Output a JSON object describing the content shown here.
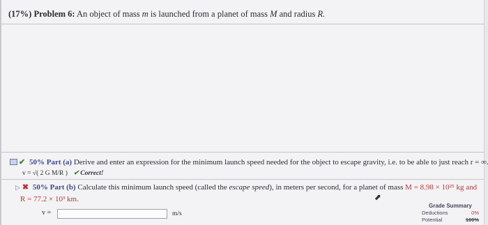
{
  "problem": {
    "percent": "(17%)",
    "label": "Problem 6:",
    "text": "An object of mass",
    "mass_var": "m",
    "text2": "is launched from a planet of mass",
    "planet_mass_var": "M",
    "text3": "and radius",
    "radius_var": "R."
  },
  "part_a": {
    "percent": "50%",
    "label": "Part (a)",
    "description": "Derive and enter an expression for the minimum launch speed needed for the object to escape gravity, i.e. to be able to just reach r = ∞.",
    "answer": "v = √( 2 G M/R )",
    "status": "Correct!"
  },
  "part_b": {
    "percent": "50%",
    "label": "Part (b)",
    "description_pre": "Calculate this minimum launch speed (called the",
    "escape_term": "escape speed",
    "description_post": "), in meters per second, for a planet of mass",
    "mass_expr": "M = 8.98 × 10²⁵ kg and",
    "radius_expr": "R = 77.2 × 10³ km.",
    "input_label": "v =",
    "input_value": "",
    "unit": "m/s"
  },
  "grade_summary": {
    "title": "Grade Summary",
    "deductions_label": "Deductions",
    "deductions_value": "0%",
    "potential_label": "Potential",
    "potential_value": "100%"
  }
}
